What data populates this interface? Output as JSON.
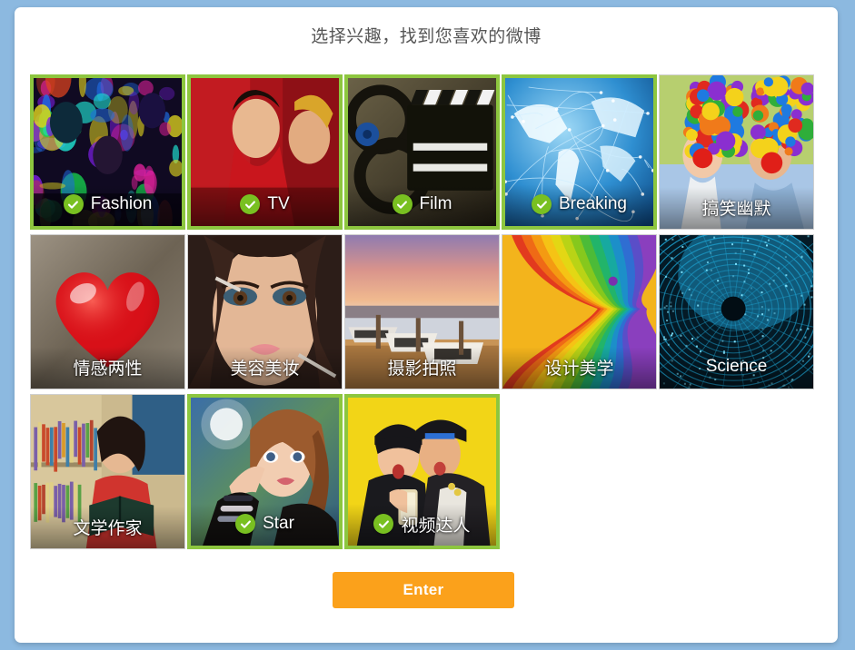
{
  "dialog": {
    "title": "选择兴趣，找到您喜欢的微博",
    "enter_label": "Enter",
    "accent_selected": "#8dc63f",
    "accent_badge": "#79c021",
    "accent_button": "#fba11b",
    "page_background": "#8cb9e0",
    "panel_background": "#ffffff"
  },
  "grid": {
    "rows": [
      [
        {
          "label": "Fashion",
          "selected": true,
          "art": "fashion-neon-crowd"
        },
        {
          "label": "TV",
          "selected": true,
          "art": "tv-costume-drama-red"
        },
        {
          "label": "Film",
          "selected": true,
          "art": "film-reel-clapperboard"
        },
        {
          "label": "Breaking",
          "selected": true,
          "art": "globe-network-blue"
        },
        {
          "label": "搞笑幽默",
          "selected": false,
          "art": "clown-wigs-red-nose"
        }
      ],
      [
        {
          "label": "情感两性",
          "selected": false,
          "art": "red-glossy-heart"
        },
        {
          "label": "美容美妆",
          "selected": false,
          "art": "makeup-portrait"
        },
        {
          "label": "摄影拍照",
          "selected": false,
          "art": "boats-sunset-dock"
        },
        {
          "label": "设计美学",
          "selected": false,
          "art": "rainbow-paper-swirl"
        },
        {
          "label": "Science",
          "selected": false,
          "art": "digital-tunnel-blue"
        }
      ],
      [
        {
          "label": "文学作家",
          "selected": false,
          "art": "girl-reading-bookshelf"
        },
        {
          "label": "Star",
          "selected": true,
          "art": "pop-idol-portrait"
        },
        {
          "label": "视频达人",
          "selected": true,
          "art": "two-women-selfie-yellow"
        }
      ]
    ]
  },
  "icons": {
    "check": "check-icon"
  }
}
